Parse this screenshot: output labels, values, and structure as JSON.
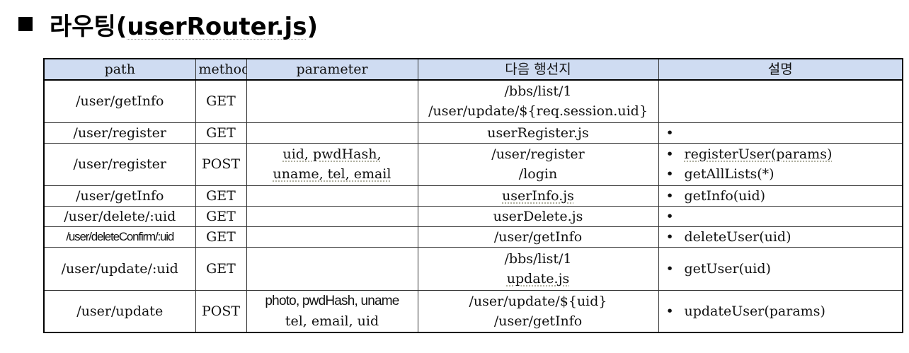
{
  "title": {
    "prefix": "라우팅(",
    "file": "userRouter.js",
    "suffix": ")"
  },
  "table": {
    "headers": [
      "path",
      "method",
      "parameter",
      "다음 행선지",
      "설명"
    ],
    "rows": [
      {
        "path": "/user/getInfo",
        "method": "GET",
        "param": [
          "",
          ""
        ],
        "next": [
          "/bbs/list/1",
          "/user/update/${req.session.uid}"
        ],
        "desc": []
      },
      {
        "path": "/user/register",
        "method": "GET",
        "param": [
          ""
        ],
        "next": [
          "userRegister.js"
        ],
        "desc": [
          ""
        ]
      },
      {
        "path": "/user/register",
        "method": "POST",
        "param": [
          "uid, pwdHash,",
          "uname, tel, email"
        ],
        "next": [
          "/user/register",
          "/login"
        ],
        "desc": [
          "registerUser(params)",
          "getAllLists(*)"
        ]
      },
      {
        "path": "/user/getInfo",
        "method": "GET",
        "param": [
          ""
        ],
        "next": [
          "userInfo.js"
        ],
        "desc": [
          "getInfo(uid)"
        ]
      },
      {
        "path": "/user/delete/:uid",
        "method": "GET",
        "param": [
          ""
        ],
        "next": [
          "userDelete.js"
        ],
        "desc": [
          ""
        ]
      },
      {
        "path": "/user/deleteConfirm/:uid",
        "method": "GET",
        "param": [
          ""
        ],
        "next": [
          "/user/getInfo"
        ],
        "desc": [
          "deleteUser(uid)"
        ]
      },
      {
        "path": "/user/update/:uid",
        "method": "GET",
        "param": [
          "",
          ""
        ],
        "next": [
          "/bbs/list/1",
          "update.js"
        ],
        "desc": [
          "getUser(uid)"
        ]
      },
      {
        "path": "/user/update",
        "method": "POST",
        "param": [
          "photo, pwdHash, uname",
          "tel, email, uid"
        ],
        "next": [
          "/user/update/${uid}",
          "/user/getInfo"
        ],
        "desc": [
          "updateUser(params)"
        ]
      }
    ]
  }
}
